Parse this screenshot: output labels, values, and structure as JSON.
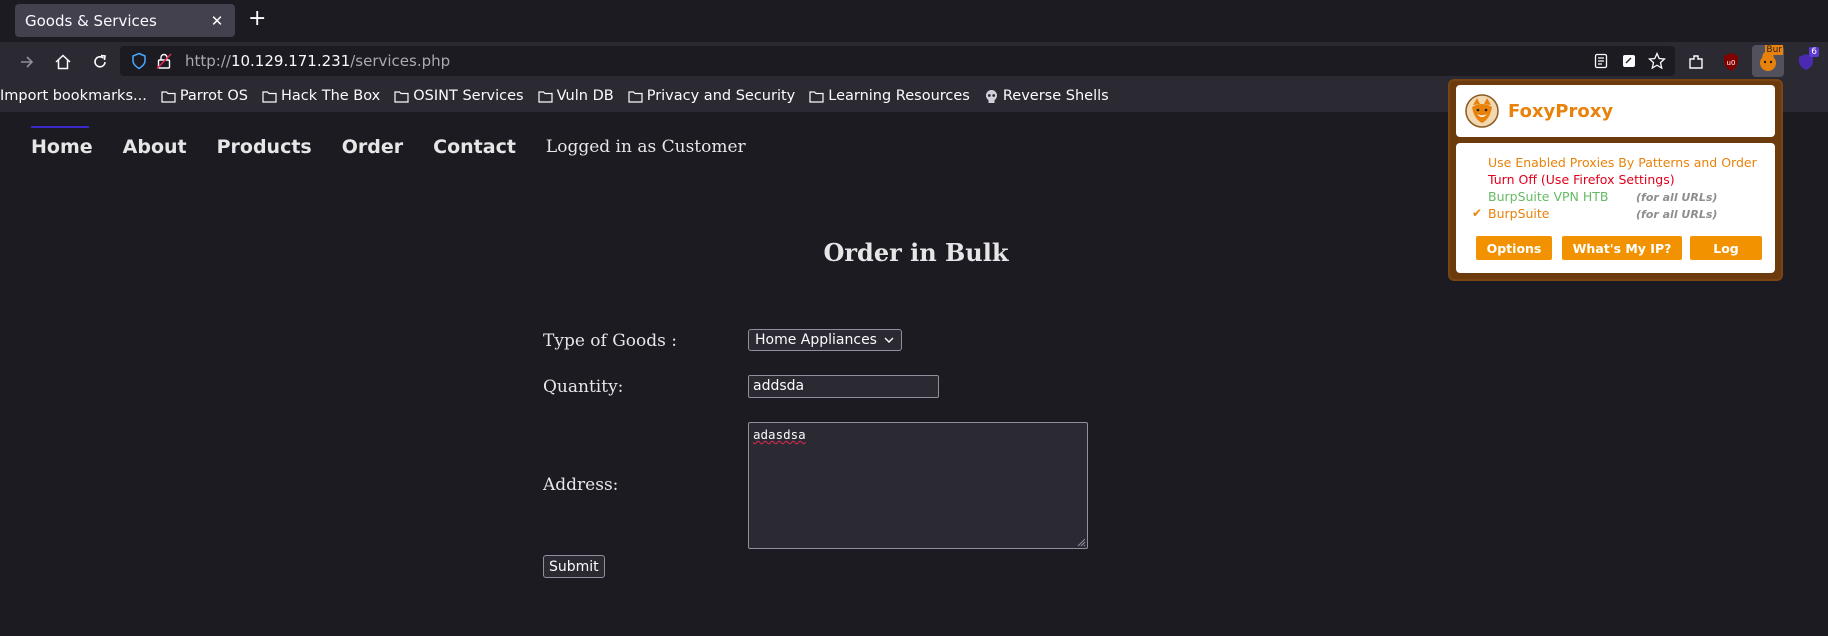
{
  "browser": {
    "tab_title": "Goods & Services",
    "new_tab": "+",
    "url_prefix": "http://",
    "url_host": "10.129.171.231",
    "url_path": "/services.php",
    "ext_badge_burp": "Bur",
    "ext_badge_count": "6"
  },
  "bookmarks": [
    {
      "label": "Import bookmarks...",
      "icon": "import-icon"
    },
    {
      "label": "Parrot OS",
      "icon": "folder-icon"
    },
    {
      "label": "Hack The Box",
      "icon": "folder-icon"
    },
    {
      "label": "OSINT Services",
      "icon": "folder-icon"
    },
    {
      "label": "Vuln DB",
      "icon": "folder-icon"
    },
    {
      "label": "Privacy and Security",
      "icon": "folder-icon"
    },
    {
      "label": "Learning Resources",
      "icon": "folder-icon"
    },
    {
      "label": "Reverse Shells",
      "icon": "skull-icon"
    }
  ],
  "site": {
    "nav": [
      "Home",
      "About",
      "Products",
      "Order",
      "Contact"
    ],
    "logged_in": "Logged in as Customer",
    "heading": "Order in Bulk",
    "form": {
      "type_label": "Type of Goods :",
      "type_value": "Home Appliances",
      "quantity_label": "Quantity:",
      "quantity_value": "addsda",
      "address_label": "Address:",
      "address_value": "adasdsa",
      "submit_label": "Submit"
    }
  },
  "foxyproxy": {
    "title": "FoxyProxy",
    "options": [
      {
        "label": "Use Enabled Proxies By Patterns and Order",
        "color": "#e8820a",
        "note": "",
        "checked": false
      },
      {
        "label": "Turn Off (Use Firefox Settings)",
        "color": "#e0001b",
        "note": "",
        "checked": false
      },
      {
        "label": "BurpSuite VPN HTB",
        "color": "#66bb66",
        "note": "(for all URLs)",
        "checked": false
      },
      {
        "label": "BurpSuite",
        "color": "#e8820a",
        "note": "(for all URLs)",
        "checked": true
      }
    ],
    "check_mark": "✔",
    "buttons": [
      "Options",
      "What's My IP?",
      "Log"
    ]
  }
}
